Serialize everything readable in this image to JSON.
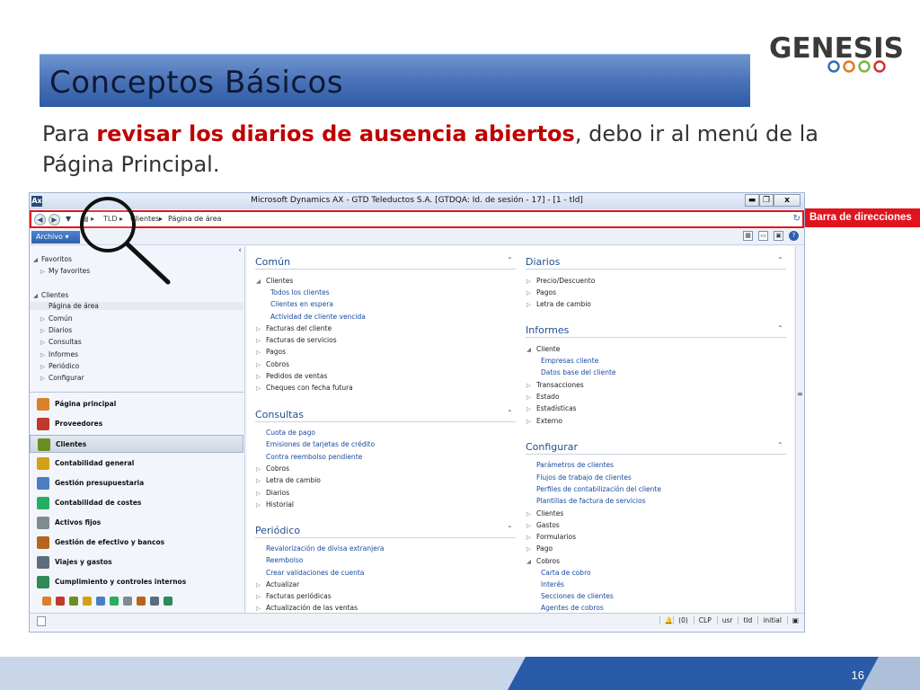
{
  "slide": {
    "title": "Conceptos Básicos",
    "logo_text": "GENESIS",
    "body": {
      "pre": "Para ",
      "highlight": "revisar los diarios de ausencia abiertos",
      "post": ", debo ir al menú de la Página Principal."
    },
    "callout": "Barra de direcciones",
    "page_number": "16"
  },
  "app": {
    "window_title": "Microsoft Dynamics AX - GTD Teleductos S.A. [GTDQA: Id. de sesión - 17] - [1 - tld]",
    "app_icon": "Ax",
    "window_buttons": [
      "▬",
      "❐",
      "x"
    ],
    "breadcrumb": [
      "TLD",
      "Clientes",
      "Página de área"
    ],
    "file_menu": "Archivo",
    "nav": {
      "favoritos_header": "Favoritos",
      "my_favorites": "My favorites",
      "clientes_header": "Clientes",
      "items": [
        "Página de área",
        "Común",
        "Diarios",
        "Consultas",
        "Informes",
        "Periódico",
        "Configurar"
      ]
    },
    "modules": [
      {
        "label": "Página principal",
        "color": "#d9822b"
      },
      {
        "label": "Proveedores",
        "color": "#c0392b"
      },
      {
        "label": "Clientes",
        "color": "#6b8e23"
      },
      {
        "label": "Contabilidad general",
        "color": "#d4a017"
      },
      {
        "label": "Gestión presupuestaria",
        "color": "#4a7fc1"
      },
      {
        "label": "Contabilidad de costes",
        "color": "#27ae60"
      },
      {
        "label": "Activos fijos",
        "color": "#7f8c8d"
      },
      {
        "label": "Gestión de efectivo y bancos",
        "color": "#b5651d"
      },
      {
        "label": "Viajes y gastos",
        "color": "#5d6d7e"
      },
      {
        "label": "Cumplimiento y controles internos",
        "color": "#2e8b57"
      }
    ],
    "sections": {
      "comun": {
        "title": "Común",
        "clientes": "Clientes",
        "sub": [
          "Todos los clientes",
          "Clientes en espera",
          "Actividad de cliente vencida"
        ],
        "items": [
          "Facturas del cliente",
          "Facturas de servicios",
          "Pagos",
          "Cobros",
          "Pedidos de ventas",
          "Cheques con fecha futura"
        ]
      },
      "consultas": {
        "title": "Consultas",
        "links": [
          "Cuota de pago",
          "Emisiones de tarjetas de crédito",
          "Contra reembolso pendiente"
        ],
        "items": [
          "Cobros",
          "Letra de cambio",
          "Diarios",
          "Historial"
        ]
      },
      "periodico": {
        "title": "Periódico",
        "links": [
          "Revalorización de divisa extranjera",
          "Reembolso",
          "Crear validaciones de cuenta"
        ],
        "items": [
          "Actualizar",
          "Facturas periódicas",
          "Actualización de las ventas"
        ]
      },
      "diarios": {
        "title": "Diarios",
        "items": [
          "Precio/Descuento",
          "Pagos",
          "Letra de cambio"
        ]
      },
      "informes": {
        "title": "Informes",
        "cliente": "Cliente",
        "sub": [
          "Empresas cliente",
          "Datos base del cliente"
        ],
        "items": [
          "Transacciones",
          "Estado",
          "Estadísticas",
          "Externo"
        ]
      },
      "configurar": {
        "title": "Configurar",
        "links": [
          "Parámetros de clientes",
          "Flujos de trabajo de clientes",
          "Perfiles de contabilización del cliente",
          "Plantillas de factura de servicios"
        ],
        "items": [
          "Clientes",
          "Gastos",
          "Formularios",
          "Pago"
        ],
        "cobros": "Cobros",
        "cobros_sub": [
          "Carta de cobro",
          "Interés",
          "Secciones de clientes",
          "Agentes de cobros"
        ]
      }
    },
    "status": [
      "(0)",
      "CLP",
      "usr",
      "tld",
      "initial"
    ]
  }
}
